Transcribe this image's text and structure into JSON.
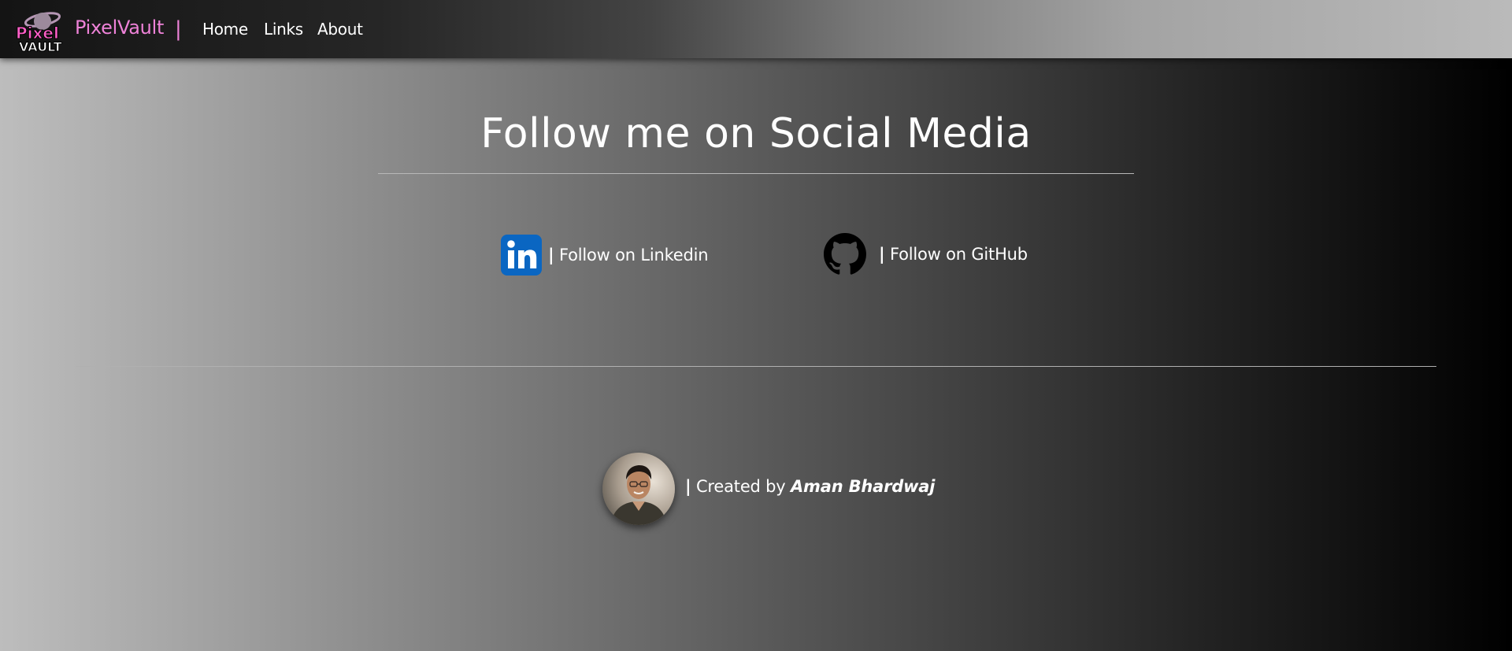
{
  "nav": {
    "brand": "PixelVault",
    "separator": "|",
    "logo_text_top": "Pixel",
    "logo_text_bottom": "VAULT",
    "links": [
      "Home",
      "Links",
      "About"
    ]
  },
  "main": {
    "title": "Follow me on Social Media",
    "socials": [
      {
        "icon": "linkedin-icon",
        "bar": "|",
        "label": "Follow on Linkedin",
        "color": "#0a66c2"
      },
      {
        "icon": "github-icon",
        "bar": "|",
        "label": "Follow on GitHub",
        "color": "#000000"
      }
    ]
  },
  "footer": {
    "bar": "|",
    "created_by": "Created by",
    "author": "Aman Bhardwaj"
  },
  "colors": {
    "brand": "#ee82d8",
    "text": "#ffffff"
  }
}
